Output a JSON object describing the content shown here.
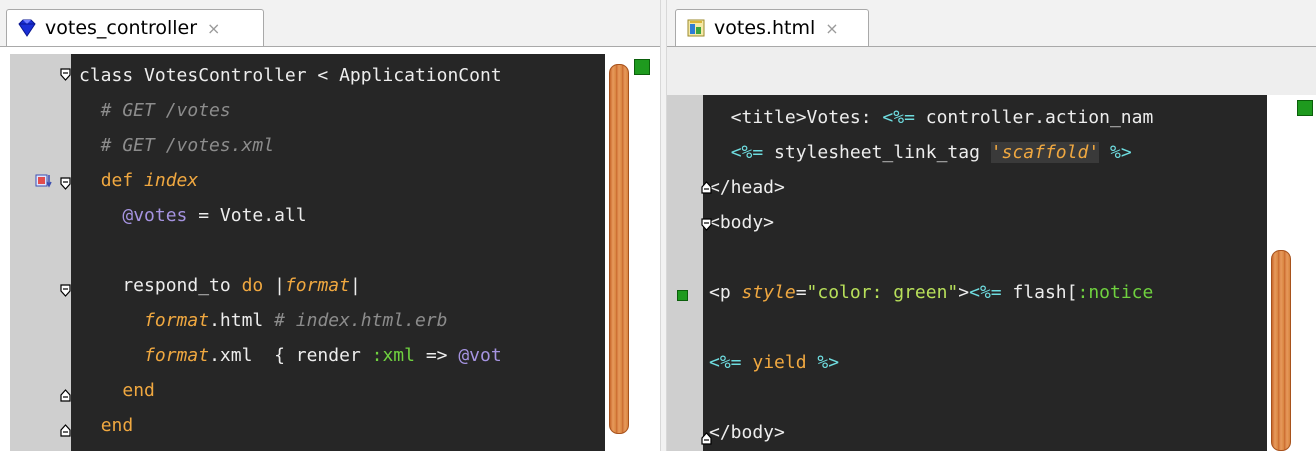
{
  "left_pane": {
    "tab": {
      "title": "votes_controller",
      "close": "×",
      "icon": "ruby-gem-icon"
    },
    "code": [
      [
        {
          "t": "class VotesController < ApplicationCont",
          "c": ""
        }
      ],
      [
        {
          "t": "  # GET /votes",
          "c": "cm"
        }
      ],
      [
        {
          "t": "  # GET /votes.xml",
          "c": "cm"
        }
      ],
      [
        {
          "t": "  ",
          "c": ""
        },
        {
          "t": "def",
          "c": "kw"
        },
        {
          "t": " ",
          "c": ""
        },
        {
          "t": "index",
          "c": "it"
        }
      ],
      [
        {
          "t": "    ",
          "c": ""
        },
        {
          "t": "@votes",
          "c": "iv"
        },
        {
          "t": " = Vote.all",
          "c": ""
        }
      ],
      [
        {
          "t": "",
          "c": ""
        }
      ],
      [
        {
          "t": "    respond_to ",
          "c": ""
        },
        {
          "t": "do",
          "c": "kw"
        },
        {
          "t": " |",
          "c": ""
        },
        {
          "t": "format",
          "c": "it"
        },
        {
          "t": "|",
          "c": ""
        }
      ],
      [
        {
          "t": "      ",
          "c": ""
        },
        {
          "t": "format",
          "c": "it"
        },
        {
          "t": ".html ",
          "c": ""
        },
        {
          "t": "# index.html.erb",
          "c": "cm"
        }
      ],
      [
        {
          "t": "      ",
          "c": ""
        },
        {
          "t": "format",
          "c": "it"
        },
        {
          "t": ".xml  { render ",
          "c": ""
        },
        {
          "t": ":xml",
          "c": "sym"
        },
        {
          "t": " => ",
          "c": ""
        },
        {
          "t": "@vot",
          "c": "iv"
        }
      ],
      [
        {
          "t": "    ",
          "c": ""
        },
        {
          "t": "end",
          "c": "kw"
        }
      ],
      [
        {
          "t": "  ",
          "c": ""
        },
        {
          "t": "end",
          "c": "kw"
        }
      ]
    ]
  },
  "right_pane": {
    "tab": {
      "title": "votes.html",
      "close": "×",
      "icon": "html-file-icon"
    },
    "code": [
      [
        {
          "t": "  <title>Votes: ",
          "c": "tag"
        },
        {
          "t": "<%=",
          "c": "erb"
        },
        {
          "t": " controller.action_nam",
          "c": ""
        }
      ],
      [
        {
          "t": "  ",
          "c": ""
        },
        {
          "t": "<%=",
          "c": "erb"
        },
        {
          "t": " stylesheet_link_tag ",
          "c": ""
        },
        {
          "t": "'scaffold'",
          "c": "strbg"
        },
        {
          "t": " ",
          "c": ""
        },
        {
          "t": "%>",
          "c": "erb"
        }
      ],
      [
        {
          "t": "</head>",
          "c": "tag"
        }
      ],
      [
        {
          "t": "<body>",
          "c": "tag"
        }
      ],
      [
        {
          "t": "",
          "c": ""
        }
      ],
      [
        {
          "t": "<p ",
          "c": "tag"
        },
        {
          "t": "style",
          "c": "attr"
        },
        {
          "t": "=",
          "c": ""
        },
        {
          "t": "\"color: green\"",
          "c": "str"
        },
        {
          "t": ">",
          "c": "tag"
        },
        {
          "t": "<%=",
          "c": "erb"
        },
        {
          "t": " flash[",
          "c": ""
        },
        {
          "t": ":notice",
          "c": "sym"
        }
      ],
      [
        {
          "t": "",
          "c": ""
        }
      ],
      [
        {
          "t": "<%=",
          "c": "erb"
        },
        {
          "t": " yield ",
          "c": "kw"
        },
        {
          "t": "%>",
          "c": "erb"
        }
      ],
      [
        {
          "t": "",
          "c": ""
        }
      ],
      [
        {
          "t": "</body>",
          "c": "tag"
        }
      ]
    ]
  }
}
